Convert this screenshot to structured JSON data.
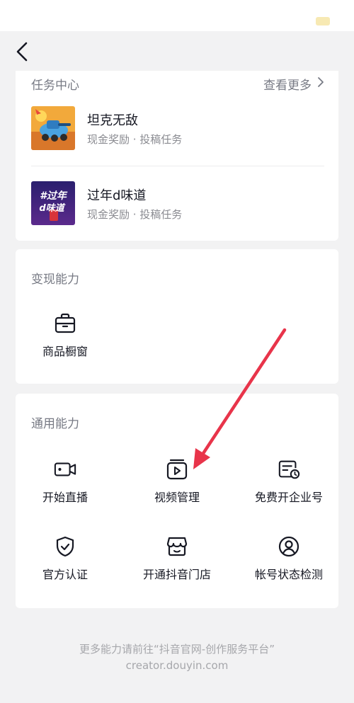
{
  "nav": {
    "back_icon": "chevron-left-icon"
  },
  "tasks_section": {
    "title": "任务中心",
    "more_label": "查看更多",
    "items": [
      {
        "name": "坦克无敌",
        "subtitle": "现金奖励 · 投稿任务",
        "thumb": "tank-thumbnail"
      },
      {
        "name": "过年d味道",
        "subtitle": "现金奖励 · 投稿任务",
        "thumb": "new-year-thumbnail",
        "thumb_text": "#过年d味道"
      }
    ]
  },
  "monetize_section": {
    "title": "变现能力",
    "items": [
      {
        "label": "商品橱窗",
        "icon": "shop-window-icon"
      }
    ]
  },
  "general_section": {
    "title": "通用能力",
    "items": [
      {
        "label": "开始直播",
        "icon": "live-camera-icon"
      },
      {
        "label": "视频管理",
        "icon": "video-manage-icon"
      },
      {
        "label": "免费开企业号",
        "icon": "enterprise-account-icon"
      },
      {
        "label": "官方认证",
        "icon": "shield-check-icon"
      },
      {
        "label": "开通抖音门店",
        "icon": "store-icon"
      },
      {
        "label": "帐号状态检测",
        "icon": "account-check-icon"
      }
    ]
  },
  "footer": {
    "line1": "更多能力请前往“抖音官网-创作服务平台”",
    "line2": "creator.douyin.com"
  },
  "colors": {
    "arrow": "#e8344a",
    "background": "#f2f2f3",
    "card": "#ffffff"
  }
}
